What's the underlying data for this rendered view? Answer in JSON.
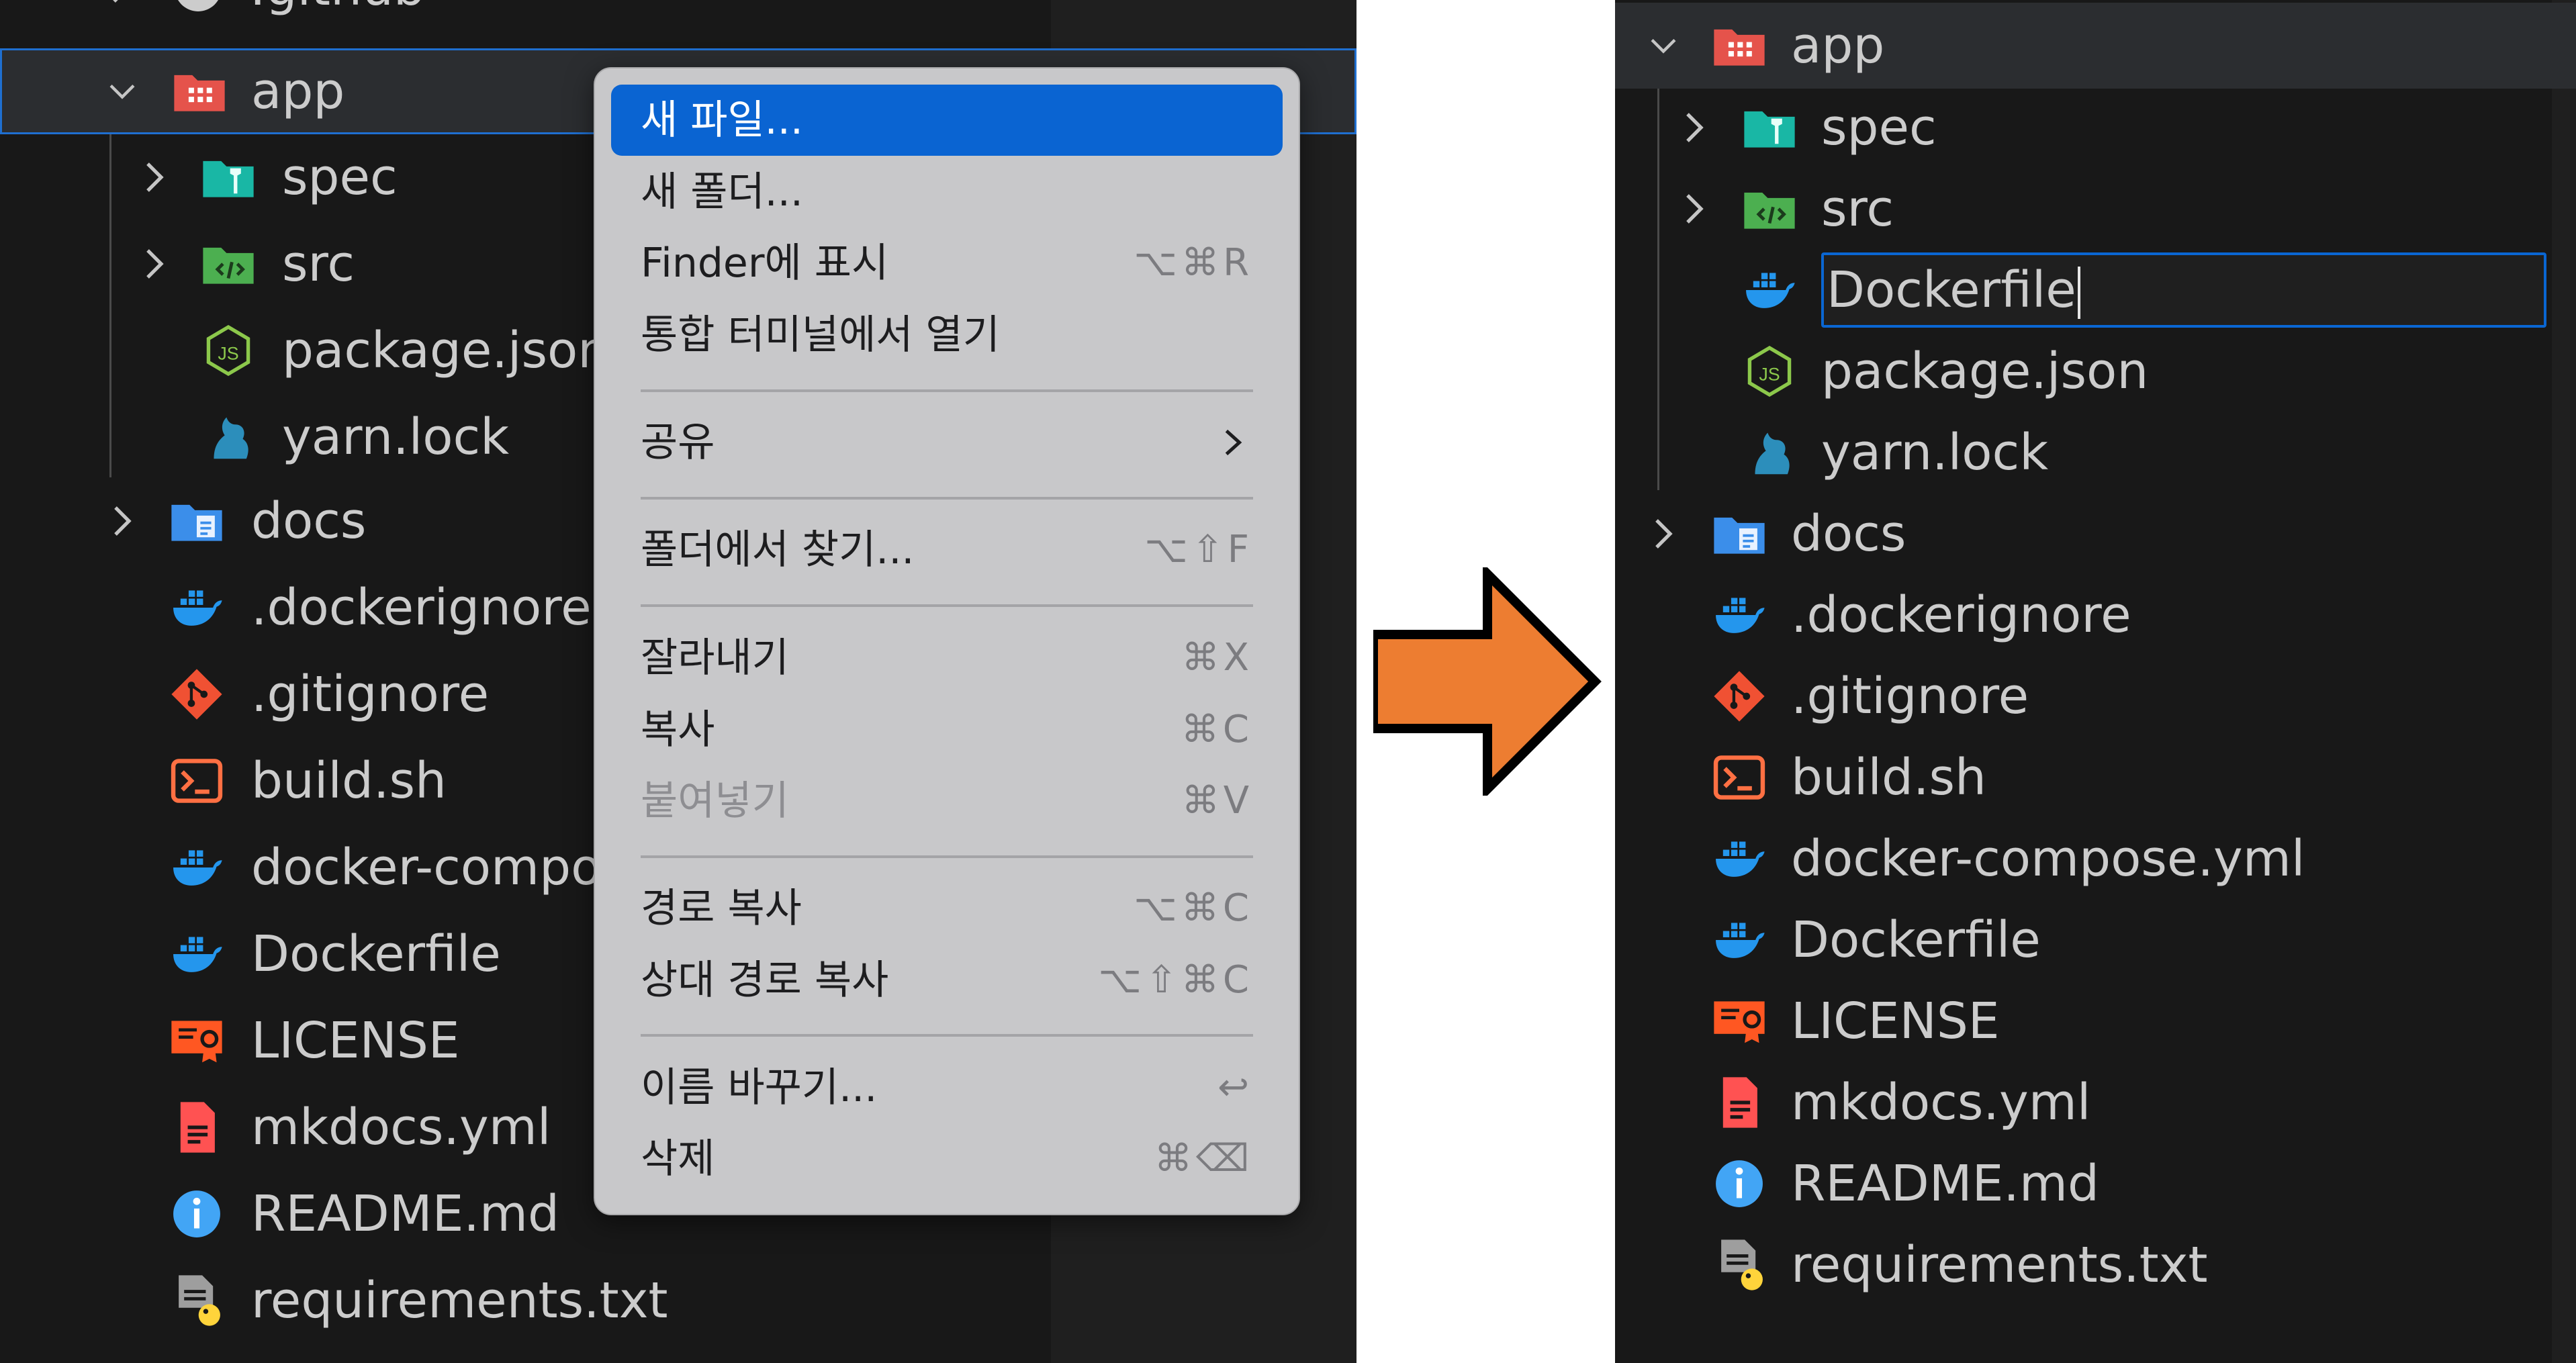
{
  "left_panel": {
    "partial_top_label": ".github",
    "folder": "app",
    "children": [
      {
        "name": "spec",
        "icon": "test-folder-icon",
        "expandable": true
      },
      {
        "name": "src",
        "icon": "source-folder-icon",
        "expandable": true
      },
      {
        "name": "package.json",
        "icon": "nodejs-icon",
        "expandable": false
      },
      {
        "name": "yarn.lock",
        "icon": "yarn-icon",
        "expandable": false
      }
    ],
    "root_items": [
      {
        "name": "docs",
        "icon": "docs-folder-icon",
        "expandable": true
      },
      {
        "name": ".dockerignore",
        "icon": "docker-icon",
        "expandable": false
      },
      {
        "name": ".gitignore",
        "icon": "git-icon",
        "expandable": false
      },
      {
        "name": "build.sh",
        "icon": "terminal-icon",
        "expandable": false
      },
      {
        "name": "docker-compo",
        "icon": "docker-icon",
        "expandable": false
      },
      {
        "name": "Dockerfile",
        "icon": "docker-icon",
        "expandable": false
      },
      {
        "name": "LICENSE",
        "icon": "license-icon",
        "expandable": false
      },
      {
        "name": "mkdocs.yml",
        "icon": "yaml-icon",
        "expandable": false
      },
      {
        "name": "README.md",
        "icon": "info-icon",
        "expandable": false
      },
      {
        "name": "requirements.txt",
        "icon": "python-requirements-icon",
        "expandable": false
      }
    ]
  },
  "context_menu": {
    "items": [
      {
        "label": "새 파일...",
        "shortcut": "",
        "highlighted": true
      },
      {
        "label": "새 폴더...",
        "shortcut": ""
      },
      {
        "label": "Finder에 표시",
        "shortcut": "⌥⌘R"
      },
      {
        "label": "통합 터미널에서 열기",
        "shortcut": ""
      },
      {
        "label": "공유",
        "shortcut": "",
        "submenu": true
      },
      {
        "label": "폴더에서 찾기...",
        "shortcut": "⌥⇧F"
      },
      {
        "label": "잘라내기",
        "shortcut": "⌘X"
      },
      {
        "label": "복사",
        "shortcut": "⌘C"
      },
      {
        "label": "붙여넣기",
        "shortcut": "⌘V",
        "disabled": true
      },
      {
        "label": "경로 복사",
        "shortcut": "⌥⌘C"
      },
      {
        "label": "상대 경로 복사",
        "shortcut": "⌥⇧⌘C"
      },
      {
        "label": "이름 바꾸기...",
        "shortcut": "↩"
      },
      {
        "label": "삭제",
        "shortcut": "⌘⌫"
      }
    ]
  },
  "arrow": {
    "color": "#ed7d31",
    "icon": "right-arrow-icon"
  },
  "right_panel": {
    "folder": "app",
    "children": [
      {
        "name": "spec",
        "icon": "test-folder-icon",
        "expandable": true
      },
      {
        "name": "src",
        "icon": "source-folder-icon",
        "expandable": true
      },
      {
        "name": "Dockerfile",
        "icon": "docker-icon",
        "editing": true
      },
      {
        "name": "package.json",
        "icon": "nodejs-icon"
      },
      {
        "name": "yarn.lock",
        "icon": "yarn-icon"
      }
    ],
    "root_items": [
      {
        "name": "docs",
        "icon": "docs-folder-icon",
        "expandable": true
      },
      {
        "name": ".dockerignore",
        "icon": "docker-icon"
      },
      {
        "name": ".gitignore",
        "icon": "git-icon"
      },
      {
        "name": "build.sh",
        "icon": "terminal-icon"
      },
      {
        "name": "docker-compose.yml",
        "icon": "docker-icon"
      },
      {
        "name": "Dockerfile",
        "icon": "docker-icon"
      },
      {
        "name": "LICENSE",
        "icon": "license-icon"
      },
      {
        "name": "mkdocs.yml",
        "icon": "yaml-icon"
      },
      {
        "name": "README.md",
        "icon": "info-icon"
      },
      {
        "name": "requirements.txt",
        "icon": "python-requirements-icon"
      }
    ]
  }
}
